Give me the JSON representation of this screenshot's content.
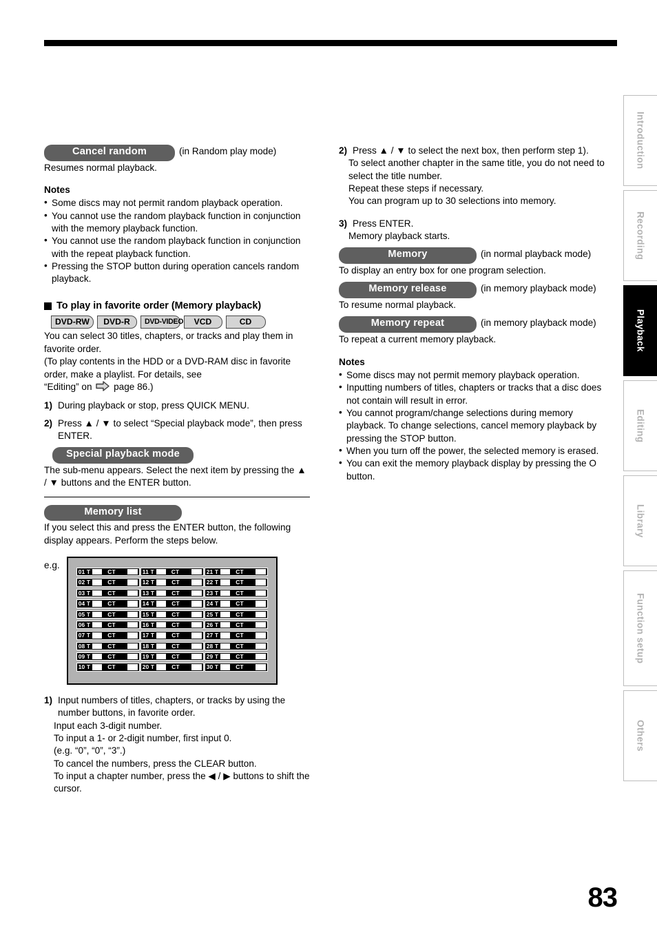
{
  "page": {
    "number": "83"
  },
  "side_tabs": [
    {
      "label": "Introduction",
      "active": false
    },
    {
      "label": "Recording",
      "active": false
    },
    {
      "label": "Playback",
      "active": true
    },
    {
      "label": "Editing",
      "active": false
    },
    {
      "label": "Library",
      "active": false
    },
    {
      "label": "Function setup",
      "active": false
    },
    {
      "label": "Others",
      "active": false
    }
  ],
  "left_column": {
    "cancel_random": {
      "pill": "Cancel random",
      "paren": "(in Random play mode)",
      "desc": "Resumes normal playback."
    },
    "notes_title": "Notes",
    "notes": [
      "Some discs may not permit random playback operation.",
      "You cannot use the random playback function in conjunction with the memory playback function.",
      "You cannot use the random playback function in conjunction with the repeat playback function.",
      "Pressing the STOP button during operation cancels random playback."
    ],
    "section": {
      "heading": "To play in favorite order (Memory playback)",
      "discs": [
        "DVD-RW",
        "DVD-R",
        "DVD-VIDEO",
        "VCD",
        "CD"
      ],
      "intro_1": "You can select 30 titles, chapters, or tracks and play them in favorite order.",
      "intro_2": "(To play contents in the HDD or a DVD-RAM disc in favorite order, make a playlist. For details, see",
      "intro_3_pre": "“Editing” on",
      "intro_3_post": "page 86.)",
      "steps": [
        {
          "num": "1)",
          "bold": "During playback or stop, press QUICK MENU."
        },
        {
          "num": "2)",
          "bold": "Press ▲ / ▼ to select “Special playback mode”, then press ENTER."
        }
      ]
    },
    "special_playback": {
      "pill": "Special playback mode",
      "desc": "The sub-menu appears. Select the next item by pressing the ▲ / ▼ buttons and the ENTER button."
    },
    "memory_list": {
      "pill": "Memory list",
      "desc": "If you select this and press the ENTER button, the following display appears. Perform the steps below.",
      "eg_label": "e.g."
    },
    "memlist_graphic": {
      "title_label": "T",
      "chapter_label": "CT",
      "columns": [
        [
          "01",
          "02",
          "03",
          "04",
          "05",
          "06",
          "07",
          "08",
          "09",
          "10"
        ],
        [
          "11",
          "12",
          "13",
          "14",
          "15",
          "16",
          "17",
          "18",
          "19",
          "20"
        ],
        [
          "21",
          "22",
          "23",
          "24",
          "25",
          "26",
          "27",
          "28",
          "29",
          "30"
        ]
      ]
    },
    "final_step": {
      "num": "1)",
      "bold": "Input numbers of titles, chapters, or tracks by using the number buttons, in favorite order.",
      "lines": [
        "Input each 3-digit number.",
        "To input a 1- or 2-digit number, first input 0.",
        " (e.g. “0”, “0”, “3”.)",
        "To cancel the numbers, press the CLEAR button.",
        "To input a chapter number, press the ◀ / ▶ buttons to shift the cursor."
      ]
    }
  },
  "right_column": {
    "step2": {
      "num": "2)",
      "bold": "Press ▲ / ▼ to select the next box, then perform step 1).",
      "lines": [
        "To select another chapter in the same title, you do not need to select the title number.",
        "Repeat these steps if necessary.",
        "You can program up to 30 selections into memory."
      ]
    },
    "step3": {
      "num": "3)",
      "bold": "Press ENTER.",
      "lines": [
        "Memory playback starts."
      ]
    },
    "memory": {
      "pill": "Memory",
      "paren": "(in normal playback mode)",
      "desc": "To display an entry box for one program selection."
    },
    "memory_release": {
      "pill": "Memory release",
      "paren": "(in memory playback mode)",
      "desc": "To resume normal playback."
    },
    "memory_repeat": {
      "pill": "Memory repeat",
      "paren": "(in memory playback mode)",
      "desc": "To repeat a current memory playback."
    },
    "notes_title": "Notes",
    "notes": [
      "Some discs may not permit memory playback operation.",
      "Inputting numbers of titles, chapters or tracks that a disc does not contain will result in error.",
      "You cannot program/change selections during memory playback. To change selections, cancel memory playback by pressing the STOP button.",
      "When you turn off the power, the selected memory is erased.",
      "You can exit the memory playback display by pressing the O button."
    ]
  }
}
